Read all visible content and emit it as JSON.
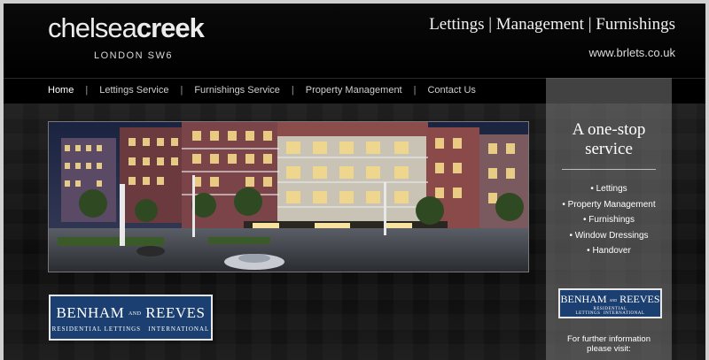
{
  "header": {
    "logo_light": "chelsea",
    "logo_bold": "creek",
    "logo_subtitle": "LONDON SW6",
    "tagline": "Lettings | Management | Furnishings",
    "url": "www.brlets.co.uk"
  },
  "nav": {
    "items": [
      "Home",
      "Lettings Service",
      "Furnishings Service",
      "Property Management",
      "Contact Us"
    ],
    "separator": "|"
  },
  "panel": {
    "title_line1": "A one-stop",
    "title_line2": "service",
    "services": [
      "• Lettings",
      "• Property Management",
      "• Furnishings",
      "• Window Dressings",
      "• Handover"
    ],
    "info_line1": "For further information",
    "info_line2": "please visit:"
  },
  "brand": {
    "name_left": "BENHAM",
    "name_and": "AND",
    "name_right": "REEVES",
    "subline_left": "RESIDENTIAL LETTINGS",
    "subline_right": "INTERNATIONAL"
  },
  "colors": {
    "background": "#080808",
    "panel": "#787878",
    "brand_blue": "#1b3f70",
    "text": "#ffffff"
  }
}
